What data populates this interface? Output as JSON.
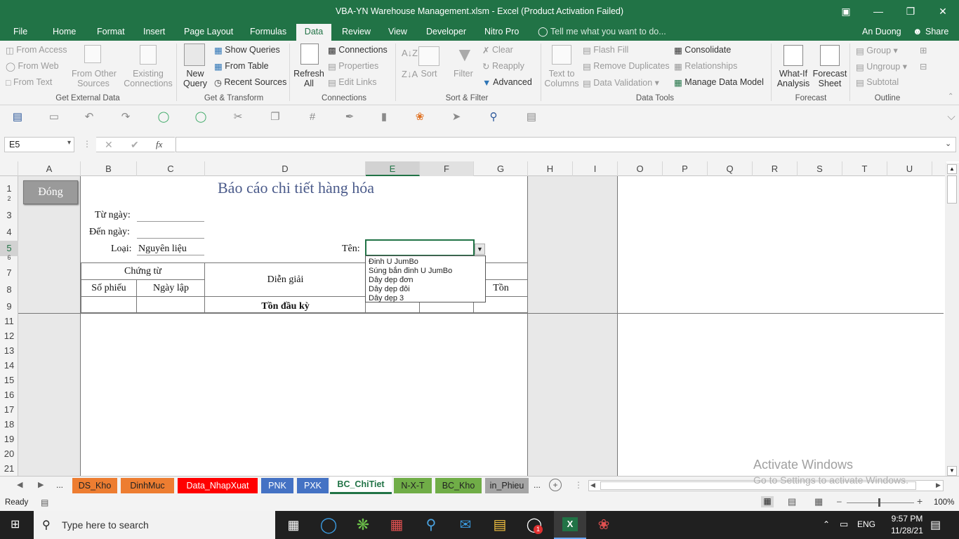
{
  "window": {
    "title": "VBA-YN Warehouse Management.xlsm - Excel (Product Activation Failed)",
    "minimize": "—",
    "restore": "❐",
    "close": "✕",
    "ribbon_display": "▣"
  },
  "tabs": [
    "File",
    "Home",
    "Format",
    "Insert",
    "Page Layout",
    "Formulas",
    "Data",
    "Review",
    "View",
    "Developer",
    "Nitro Pro"
  ],
  "active_tab": "Data",
  "tell_me": "Tell me what you want to do...",
  "user": "An Duong",
  "share": "Share",
  "ribbon": {
    "external": {
      "from_access": "From Access",
      "from_web": "From Web",
      "from_text": "From Text",
      "from_other_1": "From Other",
      "from_other_2": "Sources",
      "existing_1": "Existing",
      "existing_2": "Connections",
      "group": "Get External Data"
    },
    "transform": {
      "new_query_1": "New",
      "new_query_2": "Query",
      "show_queries": "Show Queries",
      "from_table": "From Table",
      "recent_sources": "Recent Sources",
      "group": "Get & Transform"
    },
    "connections": {
      "refresh_1": "Refresh",
      "refresh_2": "All",
      "connections": "Connections",
      "properties": "Properties",
      "edit_links": "Edit Links",
      "group": "Connections"
    },
    "sort": {
      "sort": "Sort",
      "filter": "Filter",
      "clear": "Clear",
      "reapply": "Reapply",
      "advanced": "Advanced",
      "group": "Sort & Filter"
    },
    "tools": {
      "ttc_1": "Text to",
      "ttc_2": "Columns",
      "flash_fill": "Flash Fill",
      "remove_dup": "Remove Duplicates",
      "data_validation": "Data Validation",
      "consolidate": "Consolidate",
      "relationships": "Relationships",
      "manage_model": "Manage Data Model",
      "group": "Data Tools"
    },
    "forecast": {
      "whatif_1": "What-If",
      "whatif_2": "Analysis",
      "sheet_1": "Forecast",
      "sheet_2": "Sheet",
      "group": "Forecast"
    },
    "outline": {
      "group_btn": "Group",
      "ungroup": "Ungroup",
      "subtotal": "Subtotal",
      "group": "Outline"
    }
  },
  "formula_bar": {
    "name_box": "E5",
    "fx": "fx",
    "cancel": "✕",
    "enter": "✔",
    "value": ""
  },
  "columns": [
    "A",
    "B",
    "C",
    "D",
    "E",
    "F",
    "G",
    "H",
    "I",
    "O",
    "P",
    "Q",
    "R",
    "S",
    "T",
    "U"
  ],
  "rows": [
    "1",
    "2",
    "3",
    "4",
    "5",
    "6",
    "7",
    "8",
    "9",
    "11",
    "12",
    "13",
    "14",
    "15",
    "16",
    "17",
    "18",
    "19",
    "20",
    "21"
  ],
  "sheet": {
    "close_button": "Đóng",
    "report_title": "Báo cáo chi tiết hàng hóa",
    "from_date_label": "Từ ngày:",
    "to_date_label": "Đến ngày:",
    "type_label": "Loại:",
    "type_value": "Nguyên liệu",
    "name_label": "Tên:",
    "voucher_header": "Chứng từ",
    "voucher_no": "Số phiếu",
    "date_created": "Ngày lập",
    "description": "Diễn giải",
    "stock": "Tồn",
    "opening_stock": "Tồn đầu kỳ"
  },
  "dropdown_options": [
    "Đinh U JumBo",
    "Súng bắn đinh U JumBo",
    "Dây dẹp đơn",
    "Dây dẹp đôi",
    "Dây dẹp 3"
  ],
  "sheet_tabs": [
    {
      "label": "DS_Kho",
      "color": "#ed7d31"
    },
    {
      "label": "DinhMuc",
      "color": "#ed7d31"
    },
    {
      "label": "Data_NhapXuat",
      "color": "#ff0000"
    },
    {
      "label": "PNK",
      "color": "#4472c4"
    },
    {
      "label": "PXK",
      "color": "#4472c4"
    },
    {
      "label": "BC_ChiTiet",
      "color": "#ffffff"
    },
    {
      "label": "N-X-T",
      "color": "#70ad47"
    },
    {
      "label": "BC_Kho",
      "color": "#70ad47"
    },
    {
      "label": "in_Phieu",
      "color": "#a5a5a5"
    }
  ],
  "sheet_nav": {
    "more_left": "...",
    "more_right": "...",
    "add": "+"
  },
  "status": {
    "ready": "Ready",
    "zoom": "100%"
  },
  "watermark": {
    "line1": "Activate Windows",
    "line2": "Go to Settings to activate Windows."
  },
  "taskbar": {
    "search_placeholder": "Type here to search",
    "time": "9:57 PM",
    "date": "11/28/21",
    "lang": "ENG",
    "chat_badge": "1"
  }
}
